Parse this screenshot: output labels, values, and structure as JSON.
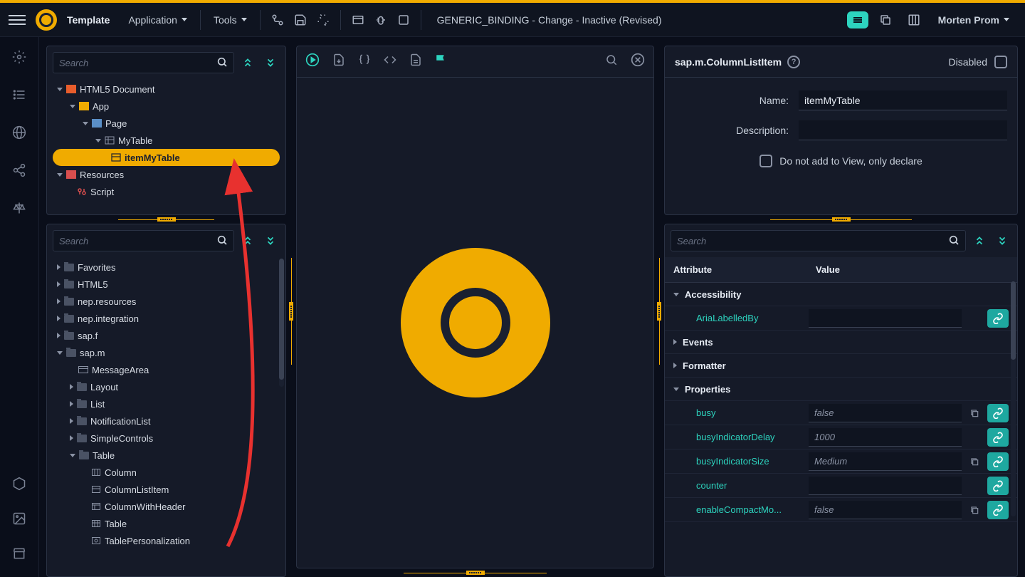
{
  "header": {
    "template_label": "Template",
    "application_label": "Application",
    "tools_label": "Tools",
    "doc_title": "GENERIC_BINDING - Change - Inactive (Revised)",
    "user_name": "Morten Prom"
  },
  "outline": {
    "search_placeholder": "Search",
    "items": {
      "html5_document": "HTML5 Document",
      "app": "App",
      "page": "Page",
      "my_table": "MyTable",
      "item_my_table": "itemMyTable",
      "resources": "Resources",
      "script": "Script"
    }
  },
  "library": {
    "search_placeholder": "Search",
    "items": {
      "favorites": "Favorites",
      "html5": "HTML5",
      "nep_resources": "nep.resources",
      "nep_integration": "nep.integration",
      "sap_f": "sap.f",
      "sap_m": "sap.m",
      "message_area": "MessageArea",
      "layout": "Layout",
      "list": "List",
      "notification_list": "NotificationList",
      "simple_controls": "SimpleControls",
      "table": "Table",
      "column": "Column",
      "column_list_item": "ColumnListItem",
      "column_with_header": "ColumnWithHeader",
      "table_item": "Table",
      "table_personalization": "TablePersonalization"
    }
  },
  "inspector": {
    "title": "sap.m.ColumnListItem",
    "disabled_label": "Disabled",
    "name_label": "Name:",
    "name_value": "itemMyTable",
    "description_label": "Description:",
    "description_value": "",
    "declare_label": "Do not add to View, only declare"
  },
  "properties": {
    "search_placeholder": "Search",
    "columns": {
      "attribute": "Attribute",
      "value": "Value"
    },
    "groups": {
      "accessibility": "Accessibility",
      "events": "Events",
      "formatter": "Formatter",
      "properties": "Properties"
    },
    "attrs": {
      "aria_labelled_by": "AriaLabelledBy",
      "busy": {
        "name": "busy",
        "value": "false"
      },
      "busy_indicator_delay": {
        "name": "busyIndicatorDelay",
        "value": "1000"
      },
      "busy_indicator_size": {
        "name": "busyIndicatorSize",
        "value": "Medium"
      },
      "counter": {
        "name": "counter",
        "value": ""
      },
      "enable_compact_mode": {
        "name": "enableCompactMo...",
        "value": "false"
      }
    }
  }
}
